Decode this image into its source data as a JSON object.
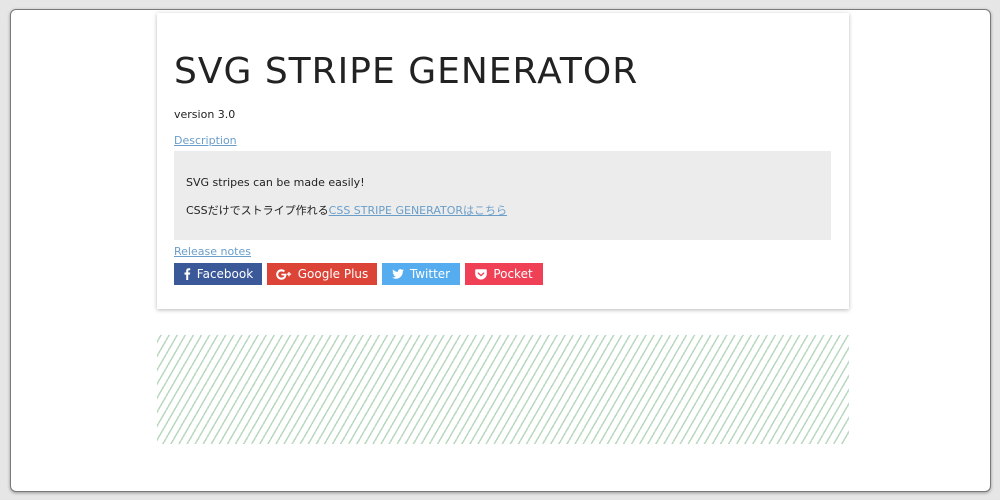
{
  "header": {
    "title": "SVG STRIPE GENERATOR",
    "version": "version 3.0"
  },
  "description": {
    "link_label": "Description",
    "line1": "SVG stripes can be made easily!",
    "line2_prefix": "CSSだけでストライプ作れる",
    "line2_link": "CSS STRIPE GENERATORはこちら"
  },
  "release_notes": {
    "link_label": "Release notes"
  },
  "share": {
    "buttons": [
      {
        "label": "Facebook",
        "icon": "facebook-icon",
        "color": "#3b5998"
      },
      {
        "label": "Google Plus",
        "icon": "google-plus-icon",
        "color": "#db4437"
      },
      {
        "label": "Twitter",
        "icon": "twitter-icon",
        "color": "#55acee"
      },
      {
        "label": "Pocket",
        "icon": "pocket-icon",
        "color": "#ef4056"
      }
    ]
  },
  "preview": {
    "stripe_color": "#b9d8be",
    "background_color": "#ffffff"
  }
}
